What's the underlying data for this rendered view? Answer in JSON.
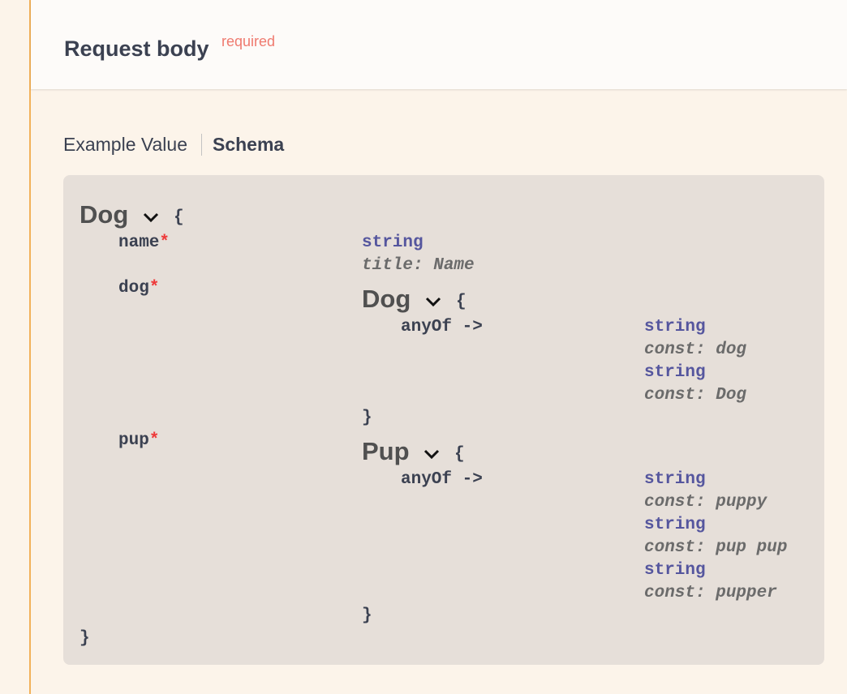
{
  "request_body": {
    "title": "Request body",
    "required_label": "required"
  },
  "tabs": {
    "example": "Example Value",
    "schema": "Schema"
  },
  "schema": {
    "model_name": "Dog",
    "open_brace": "{",
    "close_brace": "}",
    "properties": [
      {
        "name": "name",
        "required_mark": "*",
        "type": "string",
        "meta": "title: Name"
      },
      {
        "name": "dog",
        "required_mark": "*",
        "submodel": "Dog",
        "anyof_label": "anyOf ->",
        "options": [
          {
            "type": "string",
            "meta": "const: dog"
          },
          {
            "type": "string",
            "meta": "const: Dog"
          }
        ]
      },
      {
        "name": "pup",
        "required_mark": "*",
        "submodel": "Pup",
        "anyof_label": "anyOf ->",
        "options": [
          {
            "type": "string",
            "meta": "const: puppy"
          },
          {
            "type": "string",
            "meta": "const: pup pup"
          },
          {
            "type": "string",
            "meta": "const: pupper"
          }
        ]
      }
    ]
  },
  "icons": {
    "expand": "chevron-down-icon"
  },
  "colors": {
    "accent_border": "#f2b15a",
    "required": "#ef7a6f",
    "type": "#55569e"
  }
}
